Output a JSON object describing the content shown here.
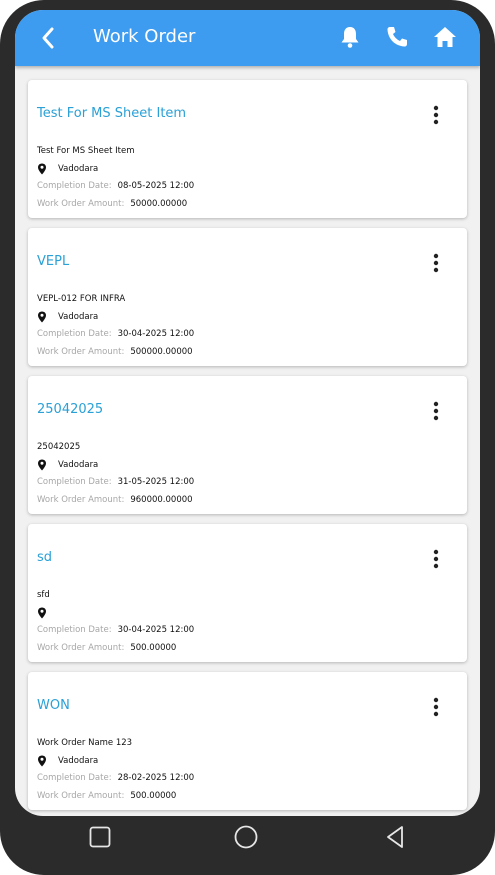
{
  "header": {
    "title": "Work Order",
    "icons": [
      "back-arrow-icon",
      "bell-icon",
      "phone-icon",
      "home-icon"
    ],
    "background": "#3d9cf0"
  },
  "labels": {
    "completion_date": "Completion Date:",
    "work_order_amount": "Work Order Amount:"
  },
  "orders": [
    {
      "title": "Test For MS Sheet Item",
      "description": "Test For MS Sheet Item",
      "location": "Vadodara",
      "completion_date": "08-05-2025 12:00",
      "amount": "50000.00000"
    },
    {
      "title": "VEPL",
      "description": "VEPL-012 FOR INFRA",
      "location": "Vadodara",
      "completion_date": "30-04-2025 12:00",
      "amount": "500000.00000"
    },
    {
      "title": "25042025",
      "description": "25042025",
      "location": "Vadodara",
      "completion_date": "31-05-2025 12:00",
      "amount": "960000.00000"
    },
    {
      "title": "sd",
      "description": "sfd",
      "location": "",
      "completion_date": "30-04-2025 12:00",
      "amount": "500.00000"
    },
    {
      "title": "WON",
      "description": "Work Order Name 123",
      "location": "Vadodara",
      "completion_date": "28-02-2025 12:00",
      "amount": "500.00000"
    }
  ],
  "colors": {
    "title_link": "#2aa0d6",
    "label_grey": "#a7a7a7",
    "frame": "#2b2b2b"
  }
}
